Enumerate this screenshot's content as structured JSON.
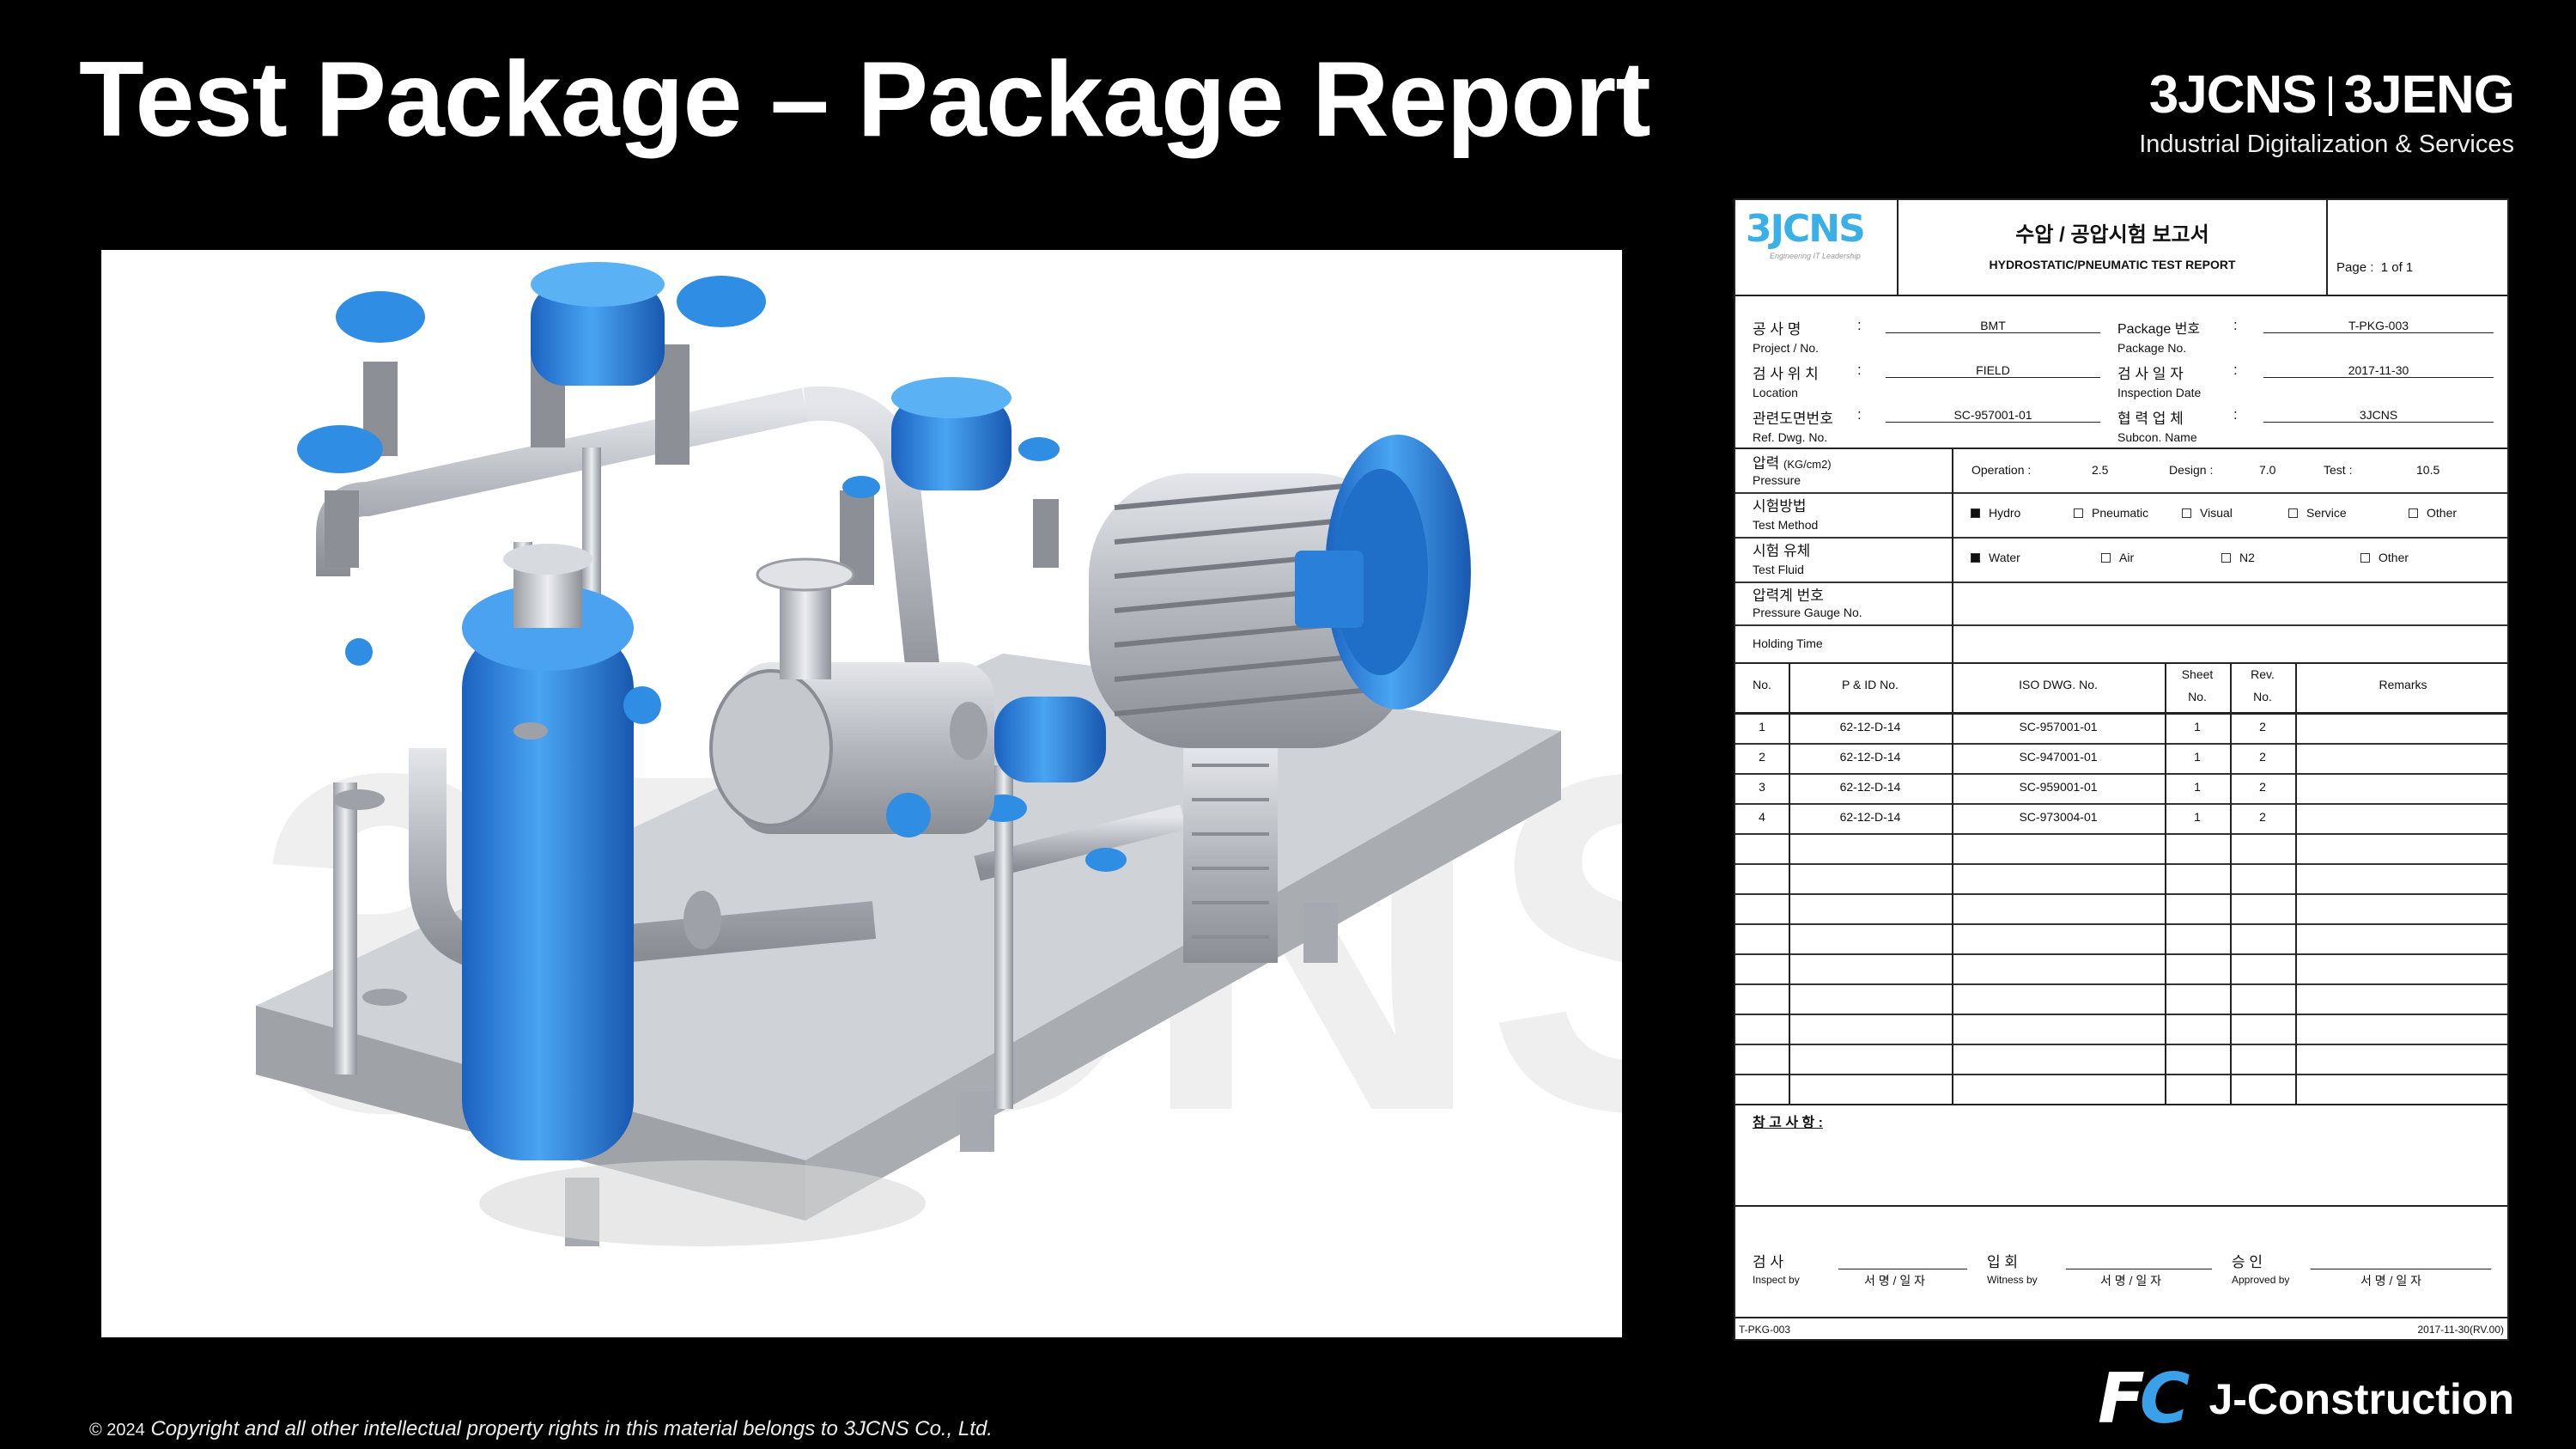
{
  "slide": {
    "title": "Test Package – Package Report",
    "brand_left": "3JCNS",
    "brand_right": "3JENG",
    "brand_subtitle": "Industrial Digitalization & Services",
    "footer_brand": "J-Construction",
    "footer_mark_f": "F",
    "footer_mark_c": "C",
    "copyright_year": "© 2024",
    "copyright_text": "Copyright and all other intellectual property rights in this material belongs to 3JCNS Co., Ltd."
  },
  "colors": {
    "accent_blue": "#2f8de4",
    "report_logo": "#3ab0e6",
    "background": "#000000"
  },
  "report": {
    "logo": "3JCNS",
    "logo_tagline": "Engineering IT Leadership",
    "title_kr": "수압 / 공압시험 보고서",
    "title_en": "HYDROSTATIC/PNEUMATIC TEST REPORT",
    "page_label": "Page :",
    "page_value": "1  of  1",
    "info": {
      "project_kr": "공  사  명",
      "project_en": "Project / No.",
      "project_val": "BMT",
      "location_kr": "검 사 위 치",
      "location_en": "Location",
      "location_val": "FIELD",
      "ref_kr": "관련도면번호",
      "ref_en": "Ref. Dwg. No.",
      "ref_val": "SC-957001-01",
      "package_kr": "Package 번호",
      "package_en": "Package No.",
      "package_val": "T-PKG-003",
      "date_kr": "검 사 일 자",
      "date_en": "Inspection Date",
      "date_val": "2017-11-30",
      "subcon_kr": "협 력 업 체",
      "subcon_en": "Subcon. Name",
      "subcon_val": "3JCNS",
      "colon": ":"
    },
    "pressure": {
      "label_kr": "압력",
      "label_unit": "(KG/cm2)",
      "label_en": "Pressure",
      "operation_label": "Operation :",
      "operation_val": "2.5",
      "design_label": "Design :",
      "design_val": "7.0",
      "test_label": "Test :",
      "test_val": "10.5"
    },
    "method": {
      "label_kr": "시험방법",
      "label_en": "Test Method",
      "options": [
        {
          "label": "Hydro",
          "checked": true
        },
        {
          "label": "Pneumatic",
          "checked": false
        },
        {
          "label": "Visual",
          "checked": false
        },
        {
          "label": "Service",
          "checked": false
        },
        {
          "label": "Other",
          "checked": false
        }
      ]
    },
    "fluid": {
      "label_kr": "시험 유체",
      "label_en": "Test Fluid",
      "options": [
        {
          "label": "Water",
          "checked": true
        },
        {
          "label": "Air",
          "checked": false
        },
        {
          "label": "N2",
          "checked": false
        },
        {
          "label": "Other",
          "checked": false
        }
      ]
    },
    "gauge": {
      "label_kr": "압력계 번호",
      "label_en": "Pressure Gauge No."
    },
    "holding": {
      "label_en": "Holding Time"
    },
    "table": {
      "headers": {
        "no": "No.",
        "pid": "P & ID No.",
        "iso": "ISO DWG. No.",
        "sheet1": "Sheet",
        "sheet2": "No.",
        "rev1": "Rev.",
        "rev2": "No.",
        "remarks": "Remarks"
      },
      "rows": [
        {
          "no": "1",
          "pid": "62-12-D-14",
          "iso": "SC-957001-01",
          "sheet": "1",
          "rev": "2"
        },
        {
          "no": "2",
          "pid": "62-12-D-14",
          "iso": "SC-947001-01",
          "sheet": "1",
          "rev": "2"
        },
        {
          "no": "3",
          "pid": "62-12-D-14",
          "iso": "SC-959001-01",
          "sheet": "1",
          "rev": "2"
        },
        {
          "no": "4",
          "pid": "62-12-D-14",
          "iso": "SC-973004-01",
          "sheet": "1",
          "rev": "2"
        }
      ]
    },
    "notes_label": "참 고 사 항 :",
    "signatures": [
      {
        "kr": "검        사",
        "en": "Inspect by",
        "sig": "서 명 / 일 자"
      },
      {
        "kr": "입        회",
        "en": "Witness by",
        "sig": "서 명 / 일 자"
      },
      {
        "kr": "승        인",
        "en": "Approved by",
        "sig": "서 명 / 일 자"
      }
    ],
    "footer_left": "T-PKG-003",
    "footer_right": "2017-11-30(RV.00)"
  }
}
